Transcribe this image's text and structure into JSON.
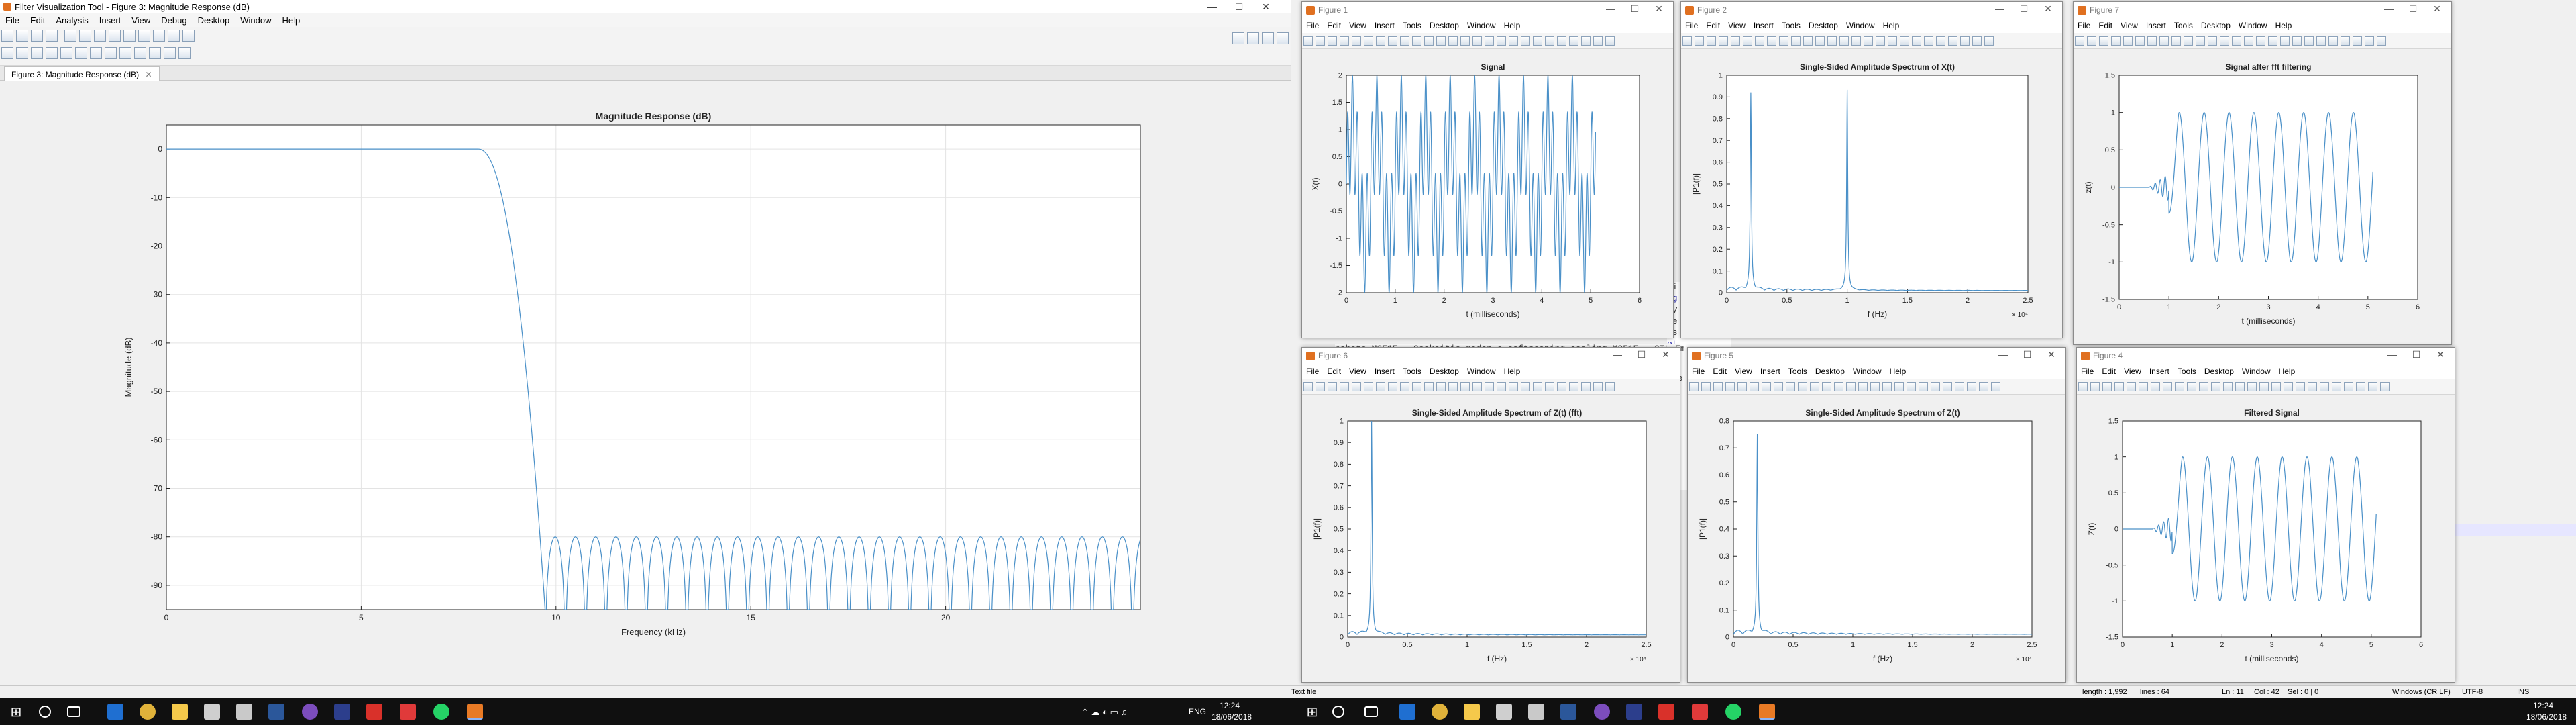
{
  "main_window": {
    "title": "Filter Visualization Tool - Figure 3: Magnitude Response (dB)",
    "menu": [
      "File",
      "Edit",
      "Analysis",
      "Insert",
      "View",
      "Debug",
      "Desktop",
      "Window",
      "Help"
    ],
    "tab_label": "Figure 3: Magnitude Response (dB)",
    "win_controls": {
      "minimize": "—",
      "maximize": "☐",
      "close": "✕"
    },
    "chart_title": "Magnitude Response (dB)"
  },
  "figure_menu": [
    "File",
    "Edit",
    "View",
    "Insert",
    "Tools",
    "Desktop",
    "Window",
    "Help"
  ],
  "figures": [
    {
      "window_title": "Figure 1",
      "plot_title": "Signal",
      "xlabel": "t (milliseconds)",
      "ylabel": "X(t)"
    },
    {
      "window_title": "Figure 2",
      "plot_title": "Single-Sided Amplitude Spectrum of X(t)",
      "xlabel": "f (Hz)",
      "ylabel": "|P1(f)|",
      "exponent": "× 10⁴"
    },
    {
      "window_title": "Figure 7",
      "plot_title": "Signal after fft filtering",
      "xlabel": "t (milliseconds)",
      "ylabel": "z(t)"
    },
    {
      "window_title": "Figure 6",
      "plot_title": "Single-Sided Amplitude Spectrum of Z(t) (fft)",
      "xlabel": "f (Hz)",
      "ylabel": "|P1(f)|",
      "exponent": "× 10⁴"
    },
    {
      "window_title": "Figure 5",
      "plot_title": "Single-Sided Amplitude Spectrum of Z(t)",
      "xlabel": "f (Hz)",
      "ylabel": "|P1(f)|",
      "exponent": "× 10⁴"
    },
    {
      "window_title": "Figure 4",
      "plot_title": "Filtered Signal",
      "xlabel": "t (milliseconds)",
      "ylabel": "Z(t)"
    }
  ],
  "editor_fragments": [
    "zi",
    "ug",
    "ty",
    "le",
    "ss",
    "ot",
    "s)",
    "de",
    "cre",
    "(:",
    "le",
    "Lo"
  ],
  "editor_bottom_line": "nabeto.M2F1E . Seekeitic maden.o osftcoaning.saoling.M2F1E . 3IL Embedded.Hambeeack fuo.H2M",
  "statusbar": {
    "left": "Text file",
    "length": "length : 1,992",
    "lines": "lines : 64",
    "ln": "Ln : 11",
    "col": "Col : 42",
    "sel": "Sel : 0 | 0",
    "eol": "Windows (CR LF)",
    "enc": "UTF-8",
    "mode": "INS"
  },
  "taskbar": {
    "lang": "ENG",
    "time": "12:24",
    "date": "18/06/2018",
    "time2": "12:24",
    "date2": "18/06/2018"
  },
  "chart_data": [
    {
      "type": "line",
      "title": "Magnitude Response (dB)",
      "xlabel": "Frequency (kHz)",
      "ylabel": "Magnitude (dB)",
      "xlim": [
        0,
        25
      ],
      "ylim": [
        -95,
        5
      ],
      "xticks": [
        0,
        5,
        10,
        15,
        20
      ],
      "yticks": [
        0,
        -10,
        -20,
        -30,
        -40,
        -50,
        -60,
        -70,
        -80,
        -90
      ],
      "grid": true,
      "color": "#4a90c8",
      "passband": {
        "x": [
          0,
          8.0
        ],
        "y": 0
      },
      "transition": {
        "x": [
          8.0,
          9.72
        ],
        "y": [
          0,
          -95
        ]
      },
      "stopband": {
        "start": 9.72,
        "end": 25,
        "lobe_peak": -80,
        "lobe_width_khz": 0.52
      }
    },
    {
      "type": "line",
      "title": "Signal",
      "xlabel": "t (milliseconds)",
      "ylabel": "X(t)",
      "xlim": [
        0,
        6
      ],
      "ylim": [
        -2,
        2
      ],
      "xticks": [
        0,
        1,
        2,
        3,
        4,
        5,
        6
      ],
      "yticks": [
        2,
        1.5,
        1,
        0.5,
        0,
        -0.5,
        -1,
        -1.5,
        -2
      ],
      "signal": "sin(2π·2kHz·t) + sin(2π·10kHz·t)",
      "t_range": [
        0,
        5.1
      ]
    },
    {
      "type": "line",
      "title": "Single-Sided Amplitude Spectrum of X(t)",
      "xlabel": "f (Hz)",
      "ylabel": "|P1(f)|",
      "xlim": [
        0,
        2.5
      ],
      "ylim": [
        0,
        1
      ],
      "xticks": [
        0,
        0.5,
        1,
        1.5,
        2,
        2.5
      ],
      "yticks": [
        0,
        0.1,
        0.2,
        0.3,
        0.4,
        0.5,
        0.6,
        0.7,
        0.8,
        0.9,
        1
      ],
      "peaks": [
        {
          "x": 0.2,
          "y": 0.9
        },
        {
          "x": 1.0,
          "y": 0.92
        }
      ]
    },
    {
      "type": "line",
      "title": "Signal after fft filtering",
      "xlabel": "t (milliseconds)",
      "ylabel": "z(t)",
      "xlim": [
        0,
        6
      ],
      "ylim": [
        -1.5,
        1.5
      ],
      "xticks": [
        0,
        1,
        2,
        3,
        4,
        5,
        6
      ],
      "yticks": [
        1.5,
        1,
        0.5,
        0,
        -0.5,
        -1,
        -1.5
      ],
      "signal": "sin(2π·2kHz·t) after onset",
      "onset_ms": 1.0,
      "t_range": [
        0,
        5.1
      ]
    },
    {
      "type": "line",
      "title": "Single-Sided Amplitude Spectrum of Z(t) (fft)",
      "xlabel": "f (Hz)",
      "ylabel": "|P1(f)|",
      "xlim": [
        0,
        2.5
      ],
      "ylim": [
        0,
        1
      ],
      "xticks": [
        0,
        0.5,
        1,
        1.5,
        2,
        2.5
      ],
      "yticks": [
        0,
        0.1,
        0.2,
        0.3,
        0.4,
        0.5,
        0.6,
        0.7,
        0.8,
        0.9,
        1
      ],
      "peaks": [
        {
          "x": 0.2,
          "y": 1.0
        }
      ]
    },
    {
      "type": "line",
      "title": "Single-Sided Amplitude Spectrum of Z(t)",
      "xlabel": "f (Hz)",
      "ylabel": "|P1(f)|",
      "xlim": [
        0,
        2.5
      ],
      "ylim": [
        0,
        0.8
      ],
      "xticks": [
        0,
        0.5,
        1,
        1.5,
        2,
        2.5
      ],
      "yticks": [
        0,
        0.1,
        0.2,
        0.3,
        0.4,
        0.5,
        0.6,
        0.7,
        0.8
      ],
      "peaks": [
        {
          "x": 0.2,
          "y": 0.73
        }
      ]
    },
    {
      "type": "line",
      "title": "Filtered Signal",
      "xlabel": "t (milliseconds)",
      "ylabel": "Z(t)",
      "xlim": [
        0,
        6
      ],
      "ylim": [
        -1.5,
        1.5
      ],
      "xticks": [
        0,
        1,
        2,
        3,
        4,
        5,
        6
      ],
      "yticks": [
        1.5,
        1,
        0.5,
        0,
        -0.5,
        -1,
        -1.5
      ],
      "signal": "sin(2π·2kHz·t) after onset",
      "onset_ms": 1.0,
      "t_range": [
        0,
        5.1
      ]
    }
  ]
}
